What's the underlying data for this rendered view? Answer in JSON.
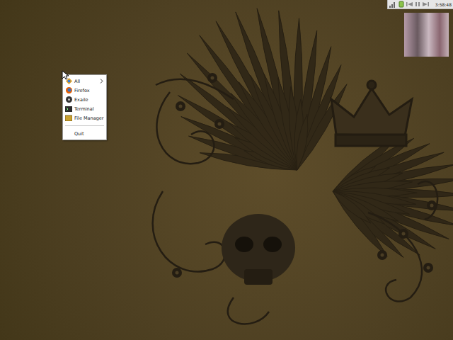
{
  "desktop": {
    "menu": {
      "items": [
        {
          "kind": "entry",
          "label": "All",
          "submenu": true
        },
        {
          "kind": "entry",
          "label": "Firefox",
          "submenu": false
        },
        {
          "kind": "entry",
          "label": "Exaile",
          "submenu": false
        },
        {
          "kind": "entry",
          "label": "Terminal",
          "submenu": false
        },
        {
          "kind": "entry",
          "label": "File Manager",
          "submenu": false
        },
        {
          "kind": "separator"
        },
        {
          "kind": "entry",
          "label": "Quit",
          "submenu": false
        }
      ]
    },
    "panel": {
      "clock": "3:58:48"
    }
  }
}
